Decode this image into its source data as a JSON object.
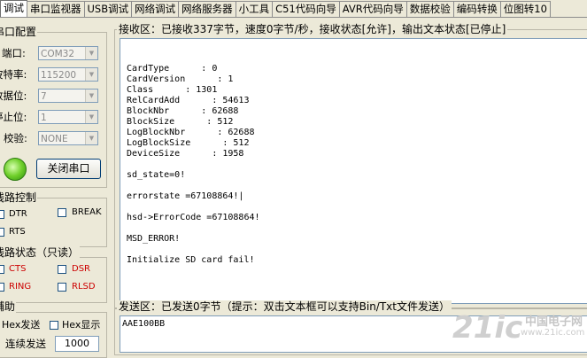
{
  "tabs": [
    "调试",
    "串口监视器",
    "USB调试",
    "网络调试",
    "网络服务器",
    "小工具",
    "C51代码向导",
    "AVR代码向导",
    "数据校验",
    "编码转换",
    "位图转10"
  ],
  "serial_config": {
    "title": "串口配置",
    "port_label": "端口:",
    "port_value": "COM32",
    "baud_label": "波特率:",
    "baud_value": "115200",
    "databits_label": "数据位:",
    "databits_value": "7",
    "stopbits_label": "停止位:",
    "stopbits_value": "1",
    "parity_label": "校验:",
    "parity_value": "NONE",
    "close_button": "关闭串口"
  },
  "line_control": {
    "title": "线路控制",
    "dtr": "DTR",
    "brk": "BREAK",
    "rts": "RTS"
  },
  "line_status": {
    "title": "线路状态（只读）",
    "cts": "CTS",
    "dsr": "DSR",
    "ring": "RING",
    "rlsd": "RLSD"
  },
  "assist": {
    "title": "辅助",
    "hex_send": "Hex发送",
    "hex_display": "Hex显示",
    "cont_send": "连续发送",
    "interval": "1000"
  },
  "receive": {
    "title": "接收区：已接收337字节，速度0字节/秒，接收状态[允许]，输出文本状态[已停止]",
    "lines": [
      "CardType      : 0",
      "CardVersion      : 1",
      "Class      : 1301",
      "RelCardAdd      : 54613",
      "BlockNbr      : 62688",
      "BlockSize      : 512",
      "LogBlockNbr      : 62688",
      "LogBlockSize      : 512",
      "DeviceSize      : 1958",
      "",
      "sd_state=0!",
      "",
      "errorstate =67108864!|",
      "",
      "hsd->ErrorCode =67108864!",
      "",
      "MSD_ERROR!",
      "",
      "Initialize SD card fail!"
    ]
  },
  "send": {
    "title": "发送区：已发送0字节（提示：双击文本框可以支持Bin/Txt文件发送）",
    "content": "AAE100BB"
  },
  "watermark": {
    "logo": "21ic",
    "cn": "中国电子网",
    "url": "www.21ic.com"
  },
  "colors": {
    "status_red": "#cc0000",
    "border_blue": "#7f9db9"
  }
}
